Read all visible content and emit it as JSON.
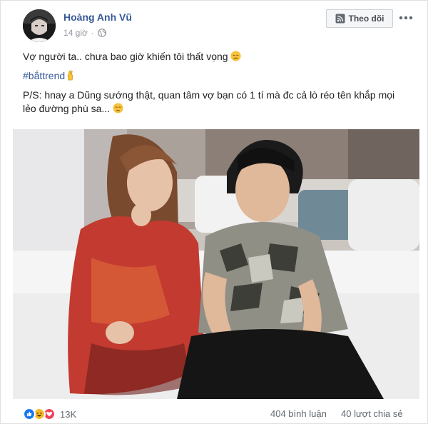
{
  "post": {
    "author_name": "Hoàng Anh Vũ",
    "timestamp": "14 giờ",
    "privacy_icon": "globe-icon",
    "follow_label": "Theo dõi",
    "follow_icon": "rss-icon",
    "more_icon": "more-dots-icon",
    "line1": "Vợ người ta.. chưa bao giờ khiến tôi thất vọng",
    "line1_emoji": "disappointed-face",
    "hashtag": "#bắttrend",
    "hashtag_emoji": "fingers-crossed",
    "line3": "P/S: hnay a Dũng sướng thật, quan tâm vợ bạn có 1 tí mà đc cả lò réo tên khắp mọi lẻo đường phù sa...",
    "line3_emoji": "sad-face",
    "photo": "couple-sitting-on-bed-photo"
  },
  "footer": {
    "reactions": [
      "like",
      "haha",
      "love"
    ],
    "reaction_count": "13K",
    "comments": "404 bình luận",
    "shares": "40 lượt chia sẻ"
  },
  "colors": {
    "link_blue": "#385898",
    "hashtag_blue": "#365899",
    "secondary_text": "#90949c",
    "like_blue": "#1877f2",
    "haha_yellow": "#f7b928",
    "love_red": "#f33e58"
  }
}
